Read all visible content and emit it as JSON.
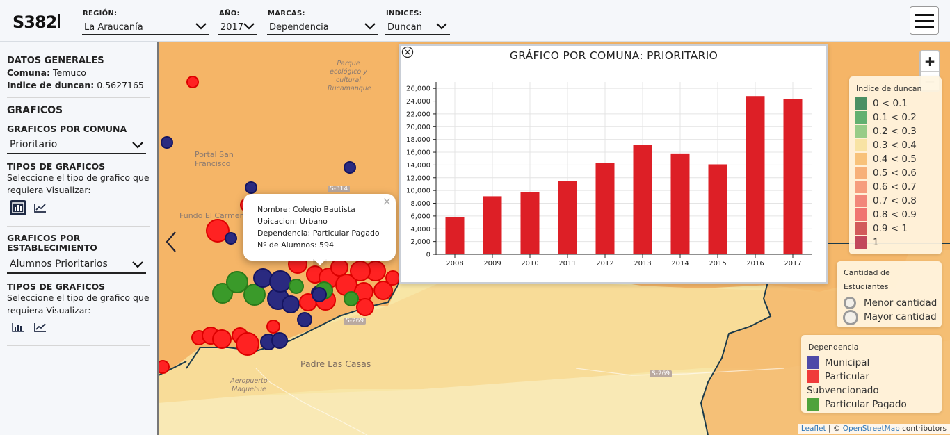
{
  "header": {
    "logo": "S382",
    "filters": [
      {
        "label": "REGIÓN:",
        "value": "La Araucanía"
      },
      {
        "label": "AÑO:",
        "value": "2017"
      },
      {
        "label": "MARCAS:",
        "value": "Dependencia"
      },
      {
        "label": "INDICES:",
        "value": "Duncan"
      }
    ],
    "menu_icon": "hamburger-icon"
  },
  "sidebar": {
    "general_title": "DATOS GENERALES",
    "comuna_label": "Comuna:",
    "comuna_value": "Temuco",
    "indice_label": "Indice de duncan:",
    "indice_value": "0.5627165",
    "graficos_title": "GRAFICOS",
    "por_comuna_title": "GRAFICOS POR COMUNA",
    "por_comuna_select": "Prioritario",
    "tipos_title_1": "TIPOS DE GRAFICOS",
    "tipos_text_1": "Seleccione el tipo de grafico que requiera Visualizar:",
    "por_establecimiento_title": "GRAFICOS POR ESTABLECIMIENTO",
    "por_establecimiento_select": "Alumnos Prioritarios",
    "tipos_title_2": "TIPOS DE GRAFICOS",
    "tipos_text_2": "Seleccione el tipo de grafico que requiera Visualizar:",
    "icons": [
      "bar-chart-icon",
      "line-chart-icon"
    ]
  },
  "map": {
    "places": {
      "porque": "Parque ecológico y cultural Rucamanque",
      "portal": "Portal San Francisco",
      "fundo": "Fundo El Carmen",
      "padre": "Padre Las Casas",
      "aeropuerto": "Aeropuerto Maquehue",
      "s314": "S-314",
      "s269a": "S-269",
      "s269b": "S-269"
    },
    "zoom_in": "+",
    "zoom_out": "−",
    "popup": {
      "close": "×",
      "nombre": "Nombre: Colegio Bautista",
      "ubicacion": "Ubicacion: Urbano",
      "dependencia": "Dependencia: Particular Pagado",
      "alumnos": "Nº de Alumnos: 594"
    },
    "attribution": {
      "leaflet": "Leaflet",
      "sep": " | © ",
      "osm": "OpenStreetMap",
      "rest": " contributors"
    }
  },
  "chart_panel": {
    "title": "GRÁFICO POR COMUNA: PRIORITARIO",
    "close_icon": "close-circle-icon"
  },
  "chart_data": {
    "type": "bar",
    "title": "GRÁFICO POR COMUNA: PRIORITARIO",
    "categories": [
      "2008",
      "2009",
      "2010",
      "2011",
      "2012",
      "2013",
      "2014",
      "2015",
      "2016",
      "2017"
    ],
    "values": [
      5800,
      9100,
      9800,
      11500,
      14300,
      17100,
      15800,
      14100,
      24800,
      24300
    ],
    "yticks": [
      0,
      2000,
      4000,
      6000,
      8000,
      10000,
      12000,
      14000,
      16000,
      18000,
      20000,
      22000,
      24000,
      26000
    ],
    "ylim": [
      0,
      27000
    ],
    "grid": true,
    "bar_color": "#dd1f26"
  },
  "legend_duncan": {
    "title": "Indice de duncan",
    "items": [
      {
        "label": "0 < 0.1",
        "color": "#4a8f63"
      },
      {
        "label": "0.1 < 0.2",
        "color": "#62b070"
      },
      {
        "label": "0.2 < 0.3",
        "color": "#98cc88"
      },
      {
        "label": "0.3 < 0.4",
        "color": "#f8e3a4"
      },
      {
        "label": "0.4 < 0.5",
        "color": "#f8c27a"
      },
      {
        "label": "0.5 < 0.6",
        "color": "#f7b079"
      },
      {
        "label": "0.6 < 0.7",
        "color": "#f69d7d"
      },
      {
        "label": "0.7 < 0.8",
        "color": "#f2877a"
      },
      {
        "label": "0.8 < 0.9",
        "color": "#f07470"
      },
      {
        "label": "0.9 < 1",
        "color": "#d25a5a"
      },
      {
        "label": "1",
        "color": "#c2485c"
      }
    ]
  },
  "legend_cantidad": {
    "title_1": "Cantidad de",
    "title_2": "Estudiantes",
    "menor": "Menor cantidad",
    "mayor": "Mayor cantidad"
  },
  "legend_dependencia": {
    "title": "Dependencia",
    "municipal": "Municipal",
    "particular_1": "Particular",
    "particular_2": "Subvencionado",
    "pagado": "Particular Pagado",
    "colors": {
      "municipal": "#4f4aa8",
      "particular": "#f03a3a",
      "pagado": "#4ea23c"
    }
  }
}
